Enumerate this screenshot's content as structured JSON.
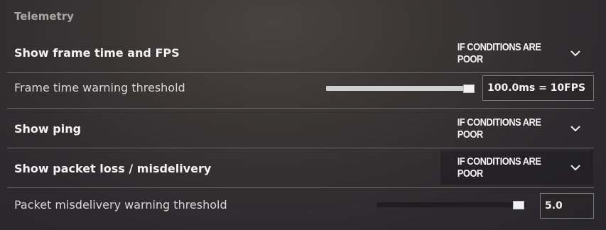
{
  "section_title": "Telemetry",
  "rows": [
    {
      "label": "Show frame time and FPS",
      "dropdown": "IF CONDITIONS ARE POOR"
    },
    {
      "label": "Frame time warning threshold",
      "value": "100.0ms = 10FPS",
      "slider_fraction": 0.96
    },
    {
      "label": "Show ping",
      "dropdown": "IF CONDITIONS ARE POOR"
    },
    {
      "label": "Show packet loss / misdelivery",
      "dropdown": "IF CONDITIONS ARE POOR"
    },
    {
      "label": "Packet misdelivery warning threshold",
      "value": "5.0",
      "slider_fraction": 0.96
    }
  ],
  "icons": {
    "dropdown_chevron": "chevron-down-icon"
  },
  "colors": {
    "separator": "#6d6868",
    "slider_fill": "#cfcfcf",
    "slider_empty": "#1e1d20"
  }
}
